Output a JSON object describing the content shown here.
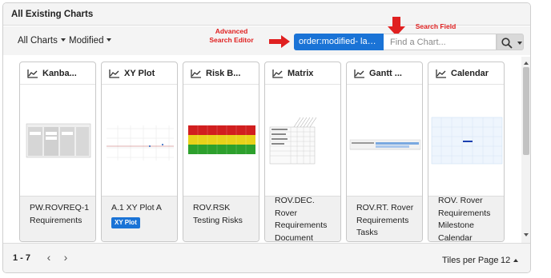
{
  "panel": {
    "title": "All Existing Charts"
  },
  "toolbar": {
    "all_charts_label": "All Charts",
    "sort_label": "Modified",
    "advanced_chip_text": "order:modified- label...",
    "search_placeholder": "Find a Chart...",
    "search_value": ""
  },
  "annotations": {
    "advanced_search_editor": "Advanced\nSearch Editor",
    "search_field": "Search Field",
    "color": "#e02020"
  },
  "cards": [
    {
      "type": "Kanba...",
      "name": "PW.ROVREQ-1 Requirements",
      "tag": ""
    },
    {
      "type": "XY Plot",
      "name": "A.1 XY Plot A",
      "tag": "XY Plot"
    },
    {
      "type": "Risk B...",
      "name": "ROV.RSK Testing Risks",
      "tag": ""
    },
    {
      "type": "Matrix",
      "name": "ROV.DEC. Rover Requirements Document",
      "tag": ""
    },
    {
      "type": "Gantt ...",
      "name": "ROV.RT. Rover Requirements Tasks",
      "tag": ""
    },
    {
      "type": "Calendar",
      "name": "ROV. Rover Requirements Milestone Calendar",
      "tag": ""
    }
  ],
  "footer": {
    "range": "1 - 7",
    "prev_label": "‹",
    "next_label": "›",
    "tiles_per_page_label": "Tiles per Page",
    "tiles_per_page_value": "12"
  },
  "colors": {
    "accent": "#1a73d6",
    "annotation": "#e02020"
  },
  "icons": [
    "chart-area-icon",
    "search-icon",
    "arrow-right-icon",
    "arrow-down-icon",
    "chevron-left-icon",
    "chevron-right-icon"
  ]
}
